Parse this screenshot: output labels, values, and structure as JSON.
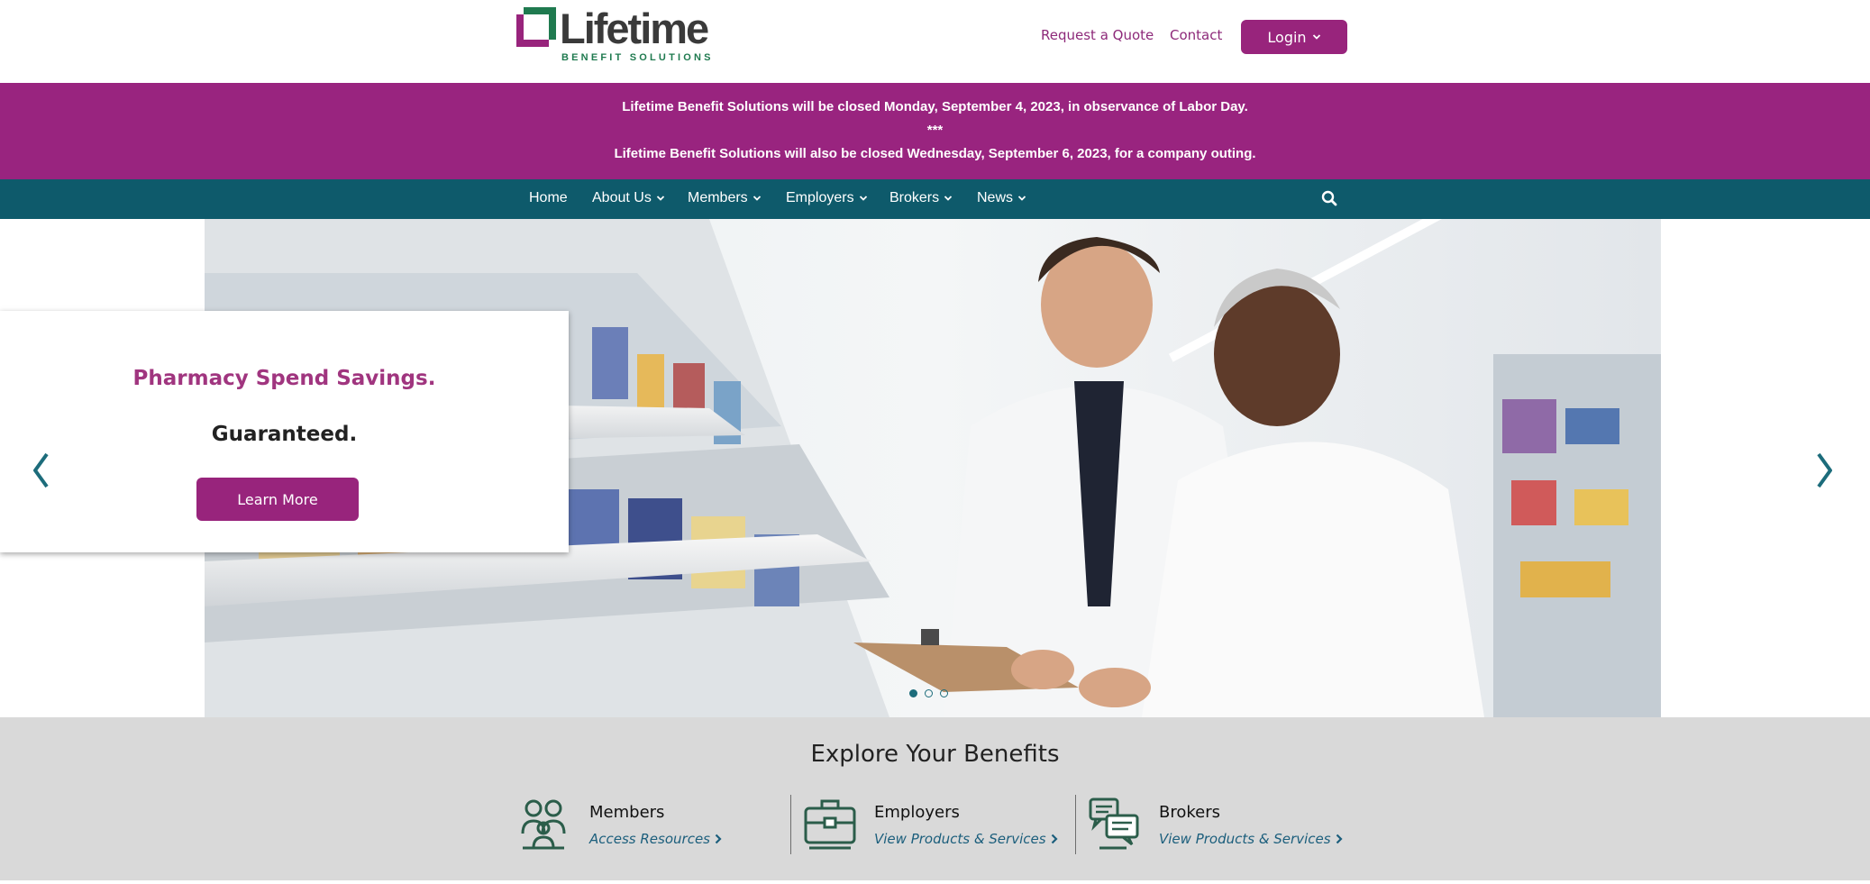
{
  "header": {
    "logo": {
      "word": "Lifetime",
      "sub": "BENEFIT SOLUTIONS",
      "mark_color": "#98247c",
      "mark_accent": "#1f7a4f"
    },
    "links": {
      "request_quote": "Request a Quote",
      "contact": "Contact"
    },
    "login_label": "Login"
  },
  "alert": {
    "line1": "Lifetime Benefit Solutions will be closed Monday, September 4, 2023, in observance of Labor Day.",
    "line2": "***",
    "line3": "Lifetime Benefit Solutions will also be closed Wednesday, September 6, 2023, for a company outing."
  },
  "nav": {
    "items": [
      {
        "label": "Home",
        "dropdown": false
      },
      {
        "label": "About Us",
        "dropdown": true
      },
      {
        "label": "Members",
        "dropdown": true
      },
      {
        "label": "Employers",
        "dropdown": true
      },
      {
        "label": "Brokers",
        "dropdown": true
      },
      {
        "label": "News",
        "dropdown": true
      }
    ],
    "search_icon": "search-icon"
  },
  "hero": {
    "title": "Pharmacy Spend Savings.",
    "subtitle": "Guaranteed.",
    "cta_label": "Learn More",
    "slides_total": 3,
    "active_slide": 1,
    "prev_icon": "chevron-left-icon",
    "next_icon": "chevron-right-icon"
  },
  "explore": {
    "title": "Explore Your Benefits",
    "items": [
      {
        "name": "Members",
        "link": "Access Resources",
        "icon": "people-icon"
      },
      {
        "name": "Employers",
        "link": "View Products & Services",
        "icon": "briefcase-icon"
      },
      {
        "name": "Brokers",
        "link": "View Products & Services",
        "icon": "chat-icon"
      }
    ]
  },
  "colors": {
    "brand_purple": "#98247c",
    "nav_teal": "#0e5a6b",
    "explore_bg": "#d9d9d9",
    "link_blue": "#1b5e7c"
  }
}
